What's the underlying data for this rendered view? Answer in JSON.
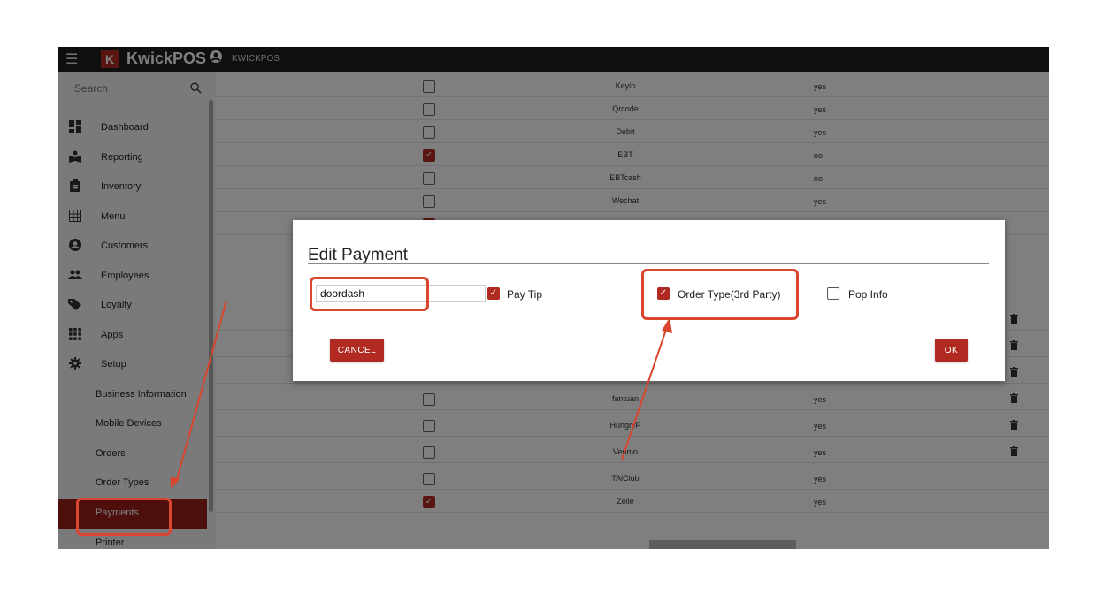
{
  "topbar": {
    "menu_icon": "☰",
    "logo_letter": "K",
    "brand": "KwickPOS",
    "account_icon": "account-circle-icon",
    "account_name": "KWICKPOS"
  },
  "sidebar": {
    "search_placeholder": "Search",
    "items": [
      {
        "label": "Dashboard",
        "icon": "dashboard-icon"
      },
      {
        "label": "Reporting",
        "icon": "reporting-icon"
      },
      {
        "label": "Inventory",
        "icon": "clipboard-icon"
      },
      {
        "label": "Menu",
        "icon": "grid-icon"
      },
      {
        "label": "Customers",
        "icon": "account-icon"
      },
      {
        "label": "Employees",
        "icon": "people-icon"
      },
      {
        "label": "Loyalty",
        "icon": "tag-icon"
      },
      {
        "label": "Apps",
        "icon": "apps-icon"
      },
      {
        "label": "Setup",
        "icon": "gear-icon"
      }
    ],
    "sub_items": [
      "Business Information",
      "Mobile Devices",
      "Orders",
      "Order Types",
      "Payments",
      "Printer"
    ]
  },
  "payments_table": {
    "rows": [
      {
        "name": "Keyin",
        "value": "yes",
        "checked": false
      },
      {
        "name": "Qrcode",
        "value": "yes",
        "checked": false
      },
      {
        "name": "Debit",
        "value": "yes",
        "checked": false
      },
      {
        "name": "EBT",
        "value": "no",
        "checked": true
      },
      {
        "name": "EBTcash",
        "value": "no",
        "checked": false
      },
      {
        "name": "Wechat",
        "value": "yes",
        "checked": false
      }
    ],
    "rows_lower": [
      {
        "name": "fantuan",
        "value": "yes",
        "checked": false
      },
      {
        "name": "HungryP",
        "value": "yes",
        "checked": false
      },
      {
        "name": "Venmo",
        "value": "yes",
        "checked": false
      },
      {
        "name": "TAlClub",
        "value": "yes",
        "checked": false
      },
      {
        "name": "Zelle",
        "value": "yes",
        "checked": true
      }
    ]
  },
  "dialog": {
    "title": "Edit Payment",
    "name_value": "doordash",
    "pay_tip_label": "Pay Tip",
    "pay_tip_checked": true,
    "order_type_label": "Order Type(3rd Party)",
    "order_type_checked": true,
    "pop_info_label": "Pop Info",
    "pop_info_checked": false,
    "cancel_label": "CANCEL",
    "ok_label": "OK"
  },
  "colors": {
    "accent": "#b02a22",
    "annotation": "#d9452f"
  }
}
